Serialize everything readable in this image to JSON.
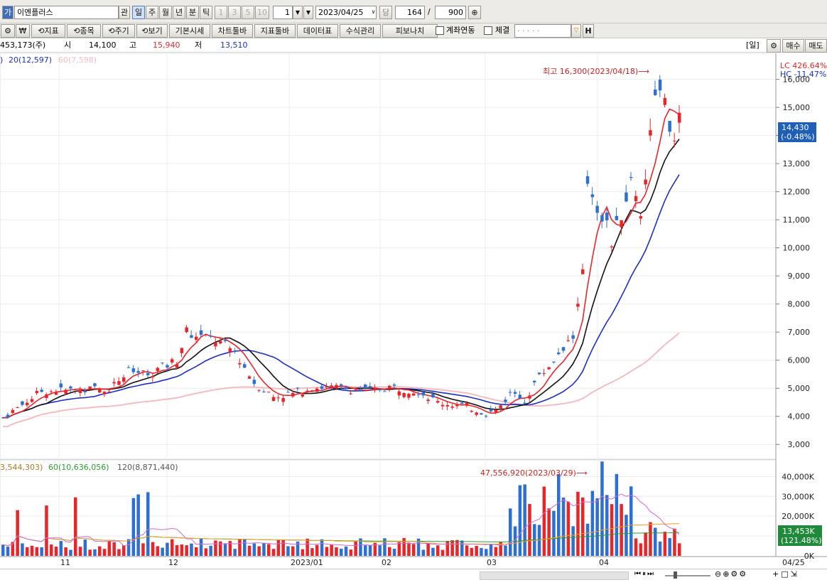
{
  "toolbar": {
    "app_icon_label": "가",
    "stock_name": "이엔플러스",
    "gwan_label": "관",
    "periods": [
      "일",
      "주",
      "월",
      "년",
      "분",
      "틱"
    ],
    "selected_period": "일",
    "minute_options": [
      "1",
      "3",
      "5",
      "10"
    ],
    "interval_value": "1",
    "date": "2023/04/25",
    "dang_label": "당",
    "count": "164",
    "slash": "/",
    "total": "900",
    "zoom_icon": "magnifier-plus-icon"
  },
  "toolbar2": {
    "buttons": [
      "⟲지표",
      "⟲종목",
      "⟲주기",
      "⟲보기",
      "기본시세",
      "차트툴바",
      "지표툴바",
      "데이터표",
      "수식관리",
      "피보나치"
    ],
    "check_linked": "계좌연동",
    "check_fill": "체결",
    "masked_account": "· · · · ·",
    "h_button": "H"
  },
  "info": {
    "volume": "453,173(주)",
    "open_label": "시",
    "open": "14,100",
    "high_label": "고",
    "high": "15,940",
    "low_label": "저",
    "low": "13,510",
    "period_badge": "[일]",
    "buy": "매수",
    "sell": "매도"
  },
  "price_legend": {
    "ma20": "20(12,597)",
    "ma60": "60(7,598)",
    "prefix": ")"
  },
  "vol_legend": {
    "ma_a": "3,544,303)",
    "ma60": "60(10,636,056)",
    "ma120": "120(8,871,440)"
  },
  "price_panel": {
    "lc": "LC 426.64%",
    "hc": "HC -11.47%",
    "high_note": "최고 16,300(2023/04/18)⟶",
    "current": "14,430",
    "current_change": "(-0.48%)",
    "ticks": [
      "16,000",
      "15,000",
      "14,000",
      "13,000",
      "12,000",
      "11,000",
      "10,000",
      "9,000",
      "8,000",
      "7,000",
      "6,000",
      "5,000",
      "4,000",
      "3,000"
    ]
  },
  "volume_panel": {
    "max_note": "47,556,920(2023/03/29)⟶",
    "ticks": [
      "40,000K",
      "30,000K",
      "20,000K",
      "10,000K",
      "0K"
    ],
    "current": "13,453K",
    "current_pct": "(121.48%)"
  },
  "x_axis": {
    "labels": [
      "11",
      "12",
      "2023/01",
      "02",
      "03",
      "04"
    ],
    "last": "04/25"
  },
  "colors": {
    "up": "#e8262a",
    "down": "#2e6fd2",
    "ma5": "#e8262a",
    "ma10": "#111111",
    "ma20": "#1b2fc4",
    "ma60": "#f5bcc4",
    "vma_a": "#d06ad6",
    "vma60": "#f0a020",
    "vma120": "#2a9d2a"
  },
  "chart_data": {
    "type": "candlestick",
    "x": [
      "2022-10-26",
      "2023-04-25"
    ],
    "candles_ohlc_sample": [
      [
        4000,
        4100,
        3880,
        4050
      ],
      [
        14100,
        15940,
        13510,
        14430
      ]
    ],
    "price_axis": [
      2500,
      16800
    ],
    "volume_axis_k": [
      0,
      48000
    ],
    "highest": {
      "value": 16300,
      "date": "2023/04/18"
    },
    "max_volume": {
      "value": 47556920,
      "date": "2023/03/29"
    }
  }
}
